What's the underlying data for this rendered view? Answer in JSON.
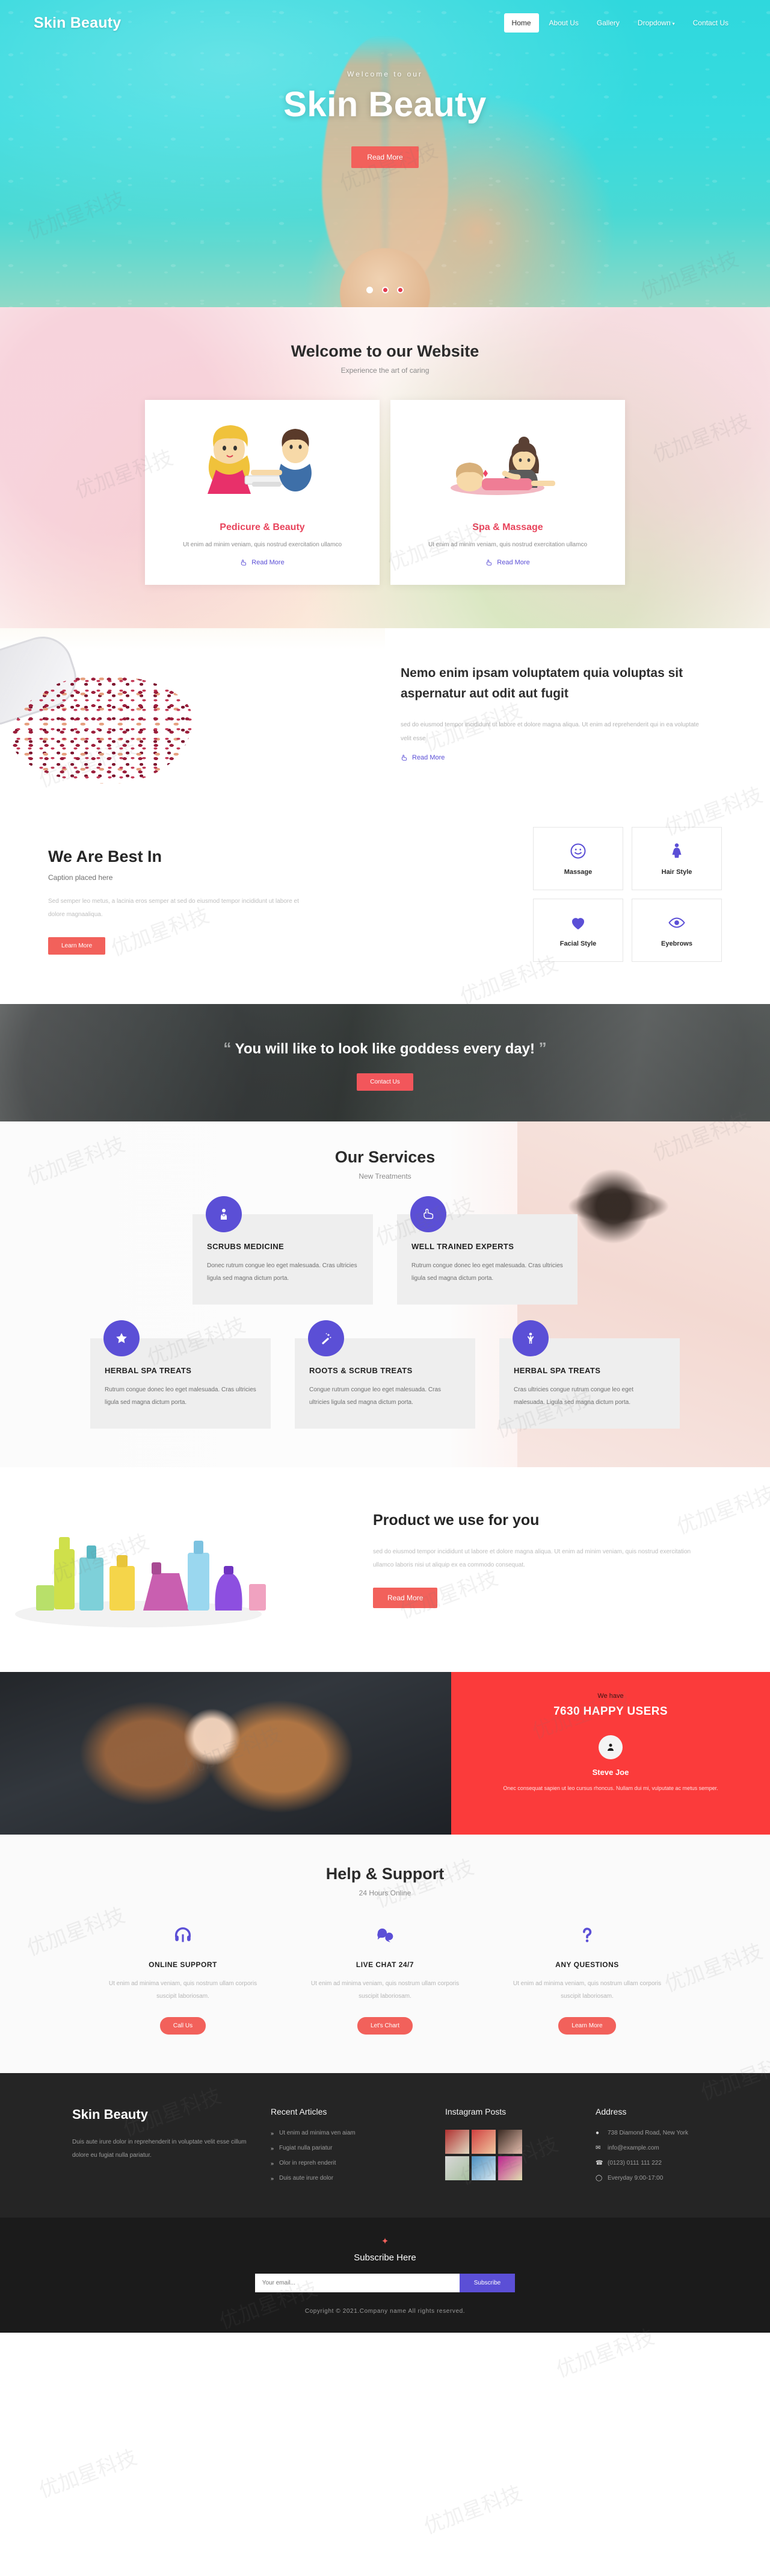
{
  "nav": {
    "brand": "Skin Beauty",
    "items": [
      {
        "label": "Home",
        "active": true
      },
      {
        "label": "About Us",
        "active": false
      },
      {
        "label": "Gallery",
        "active": false
      },
      {
        "label": "Dropdown",
        "active": false,
        "caret": "▾"
      },
      {
        "label": "Contact Us",
        "active": false
      }
    ]
  },
  "hero": {
    "kicker": "Welcome to our",
    "title": "Skin Beauty",
    "cta": "Read More",
    "slides": 3,
    "active_slide": 1
  },
  "welcome": {
    "title": "Welcome to our Website",
    "subtitle": "Experience the art of caring",
    "cards": [
      {
        "title": "Pedicure & Beauty",
        "text": "Ut enim ad minim veniam, quis nostrud exercitation ullamco",
        "link": "Read More",
        "icon": "hand-icon"
      },
      {
        "title": "Spa & Massage",
        "text": "Ut enim ad minim veniam, quis nostrud exercitation ullamco",
        "link": "Read More",
        "icon": "hand-icon"
      }
    ]
  },
  "nemo": {
    "heading": "Nemo enim ipsam voluptatem quia voluptas sit aspernatur aut odit aut fugit",
    "body": "sed do eiusmod tempor incididunt ut labore et dolore magna aliqua. Ut enim ad reprehenderit qui in ea voluptate velit esse",
    "link": "Read More"
  },
  "bestin": {
    "title": "We Are Best In",
    "caption": "Caption placed here",
    "body": "Sed semper leo metus, a lacinia eros semper at sed do eiusmod tempor incididunt ut labore et dolore magnaaliqua.",
    "cta": "Learn More",
    "tiles": [
      {
        "label": "Massage",
        "icon": "smiley-icon"
      },
      {
        "label": "Hair Style",
        "icon": "woman-icon"
      },
      {
        "label": "Facial Style",
        "icon": "heart-icon"
      },
      {
        "label": "Eyebrows",
        "icon": "eye-icon"
      }
    ]
  },
  "quote": {
    "open_mark": "“",
    "close_mark": "”",
    "text": "You will like to look like goddess every day!",
    "cta": "Contact Us"
  },
  "services": {
    "title": "Our Services",
    "subtitle": "New Treatments",
    "cards": [
      {
        "title": "SCRUBS MEDICINE",
        "text": "Donec rutrum congue leo eget malesuada. Cras ultricies ligula sed magna dictum porta.",
        "icon": "doctor-icon"
      },
      {
        "title": "WELL TRAINED EXPERTS",
        "text": "Rutrum congue donec leo eget malesuada. Cras ultricies ligula sed magna dictum porta.",
        "icon": "thumbs-up-icon"
      },
      {
        "title": "HERBAL SPA TREATS",
        "text": "Rutrum congue donec leo eget malesuada. Cras ultricies ligula sed magna dictum porta.",
        "icon": "star-icon"
      },
      {
        "title": "ROOTS & SCRUB TREATS",
        "text": "Congue rutrum congue leo eget malesuada. Cras ultricies ligula sed magna dictum porta.",
        "icon": "magic-wand-icon"
      },
      {
        "title": "HERBAL SPA TREATS",
        "text": "Cras ultricies congue rutrum congue leo eget malesuada. Ligula sed magna dictum porta.",
        "icon": "person-icon"
      }
    ]
  },
  "product": {
    "title": "Product we use for you",
    "body": "sed do eiusmod tempor incididunt ut labore et dolore magna aliqua. Ut enim ad minim veniam, quis nostrud exercitation ullamco laboris nisi ut aliquip ex ea commodo consequat.",
    "cta": "Read More"
  },
  "testimonial": {
    "kicker": "We have",
    "count": "7630 HAPPY USERS",
    "name": "Steve Joe",
    "quote": "Onec consequat sapien ut leo cursus rhoncus. Nullam dui mi, vulputate ac metus semper.",
    "avatar_icon": "user-icon"
  },
  "help": {
    "title": "Help & Support",
    "subtitle": "24 Hours Online",
    "columns": [
      {
        "title": "ONLINE SUPPORT",
        "text": "Ut enim ad minima veniam, quis nostrum ullam corporis suscipit laboriosam.",
        "cta": "Call Us",
        "icon": "headset-icon"
      },
      {
        "title": "LIVE CHAT 24/7",
        "text": "Ut enim ad minima veniam, quis nostrum ullam corporis suscipit laboriosam.",
        "cta": "Let's Chart",
        "icon": "chat-bubbles-icon"
      },
      {
        "title": "ANY QUESTIONS",
        "text": "Ut enim ad minima veniam, quis nostrum ullam corporis suscipit laboriosam.",
        "cta": "Learn More",
        "icon": "question-mark-icon"
      }
    ]
  },
  "footer": {
    "brand": "Skin Beauty",
    "about": "Duis aute irure dolor in reprehenderit in voluptate velit esse cillum dolore eu fugiat nulla pariatur.",
    "articles_heading": "Recent Articles",
    "articles": [
      "Ut enim ad minima ven aiam",
      "Fugiat nulla pariatur",
      "Olor in repreh enderit",
      "Duis aute irure dolor"
    ],
    "instagram_heading": "Instagram Posts",
    "instagram_count": 6,
    "address_heading": "Address",
    "address": [
      {
        "icon": "map-pin-icon",
        "text": "738 Diamond Road, New York"
      },
      {
        "icon": "envelope-icon",
        "text": "info@example.com"
      },
      {
        "icon": "phone-icon",
        "text": "(0123) 0111 111 222"
      },
      {
        "icon": "clock-icon",
        "text": "Everyday 9:00-17:00"
      }
    ],
    "subscribe_heading": "Subscribe Here",
    "subscribe_placeholder": "Your email...",
    "subscribe_value": "",
    "subscribe_button": "Subscribe",
    "copyright": "Copyright © 2021.Company name All rights reserved."
  },
  "colors": {
    "accent_red": "#f2615b",
    "accent_purple": "#5b4fd6",
    "brand_pink": "#e8445c",
    "hero_teal": "#36dbdf",
    "testimonial_red": "#fb3b3b",
    "footer_dark": "#252525"
  }
}
